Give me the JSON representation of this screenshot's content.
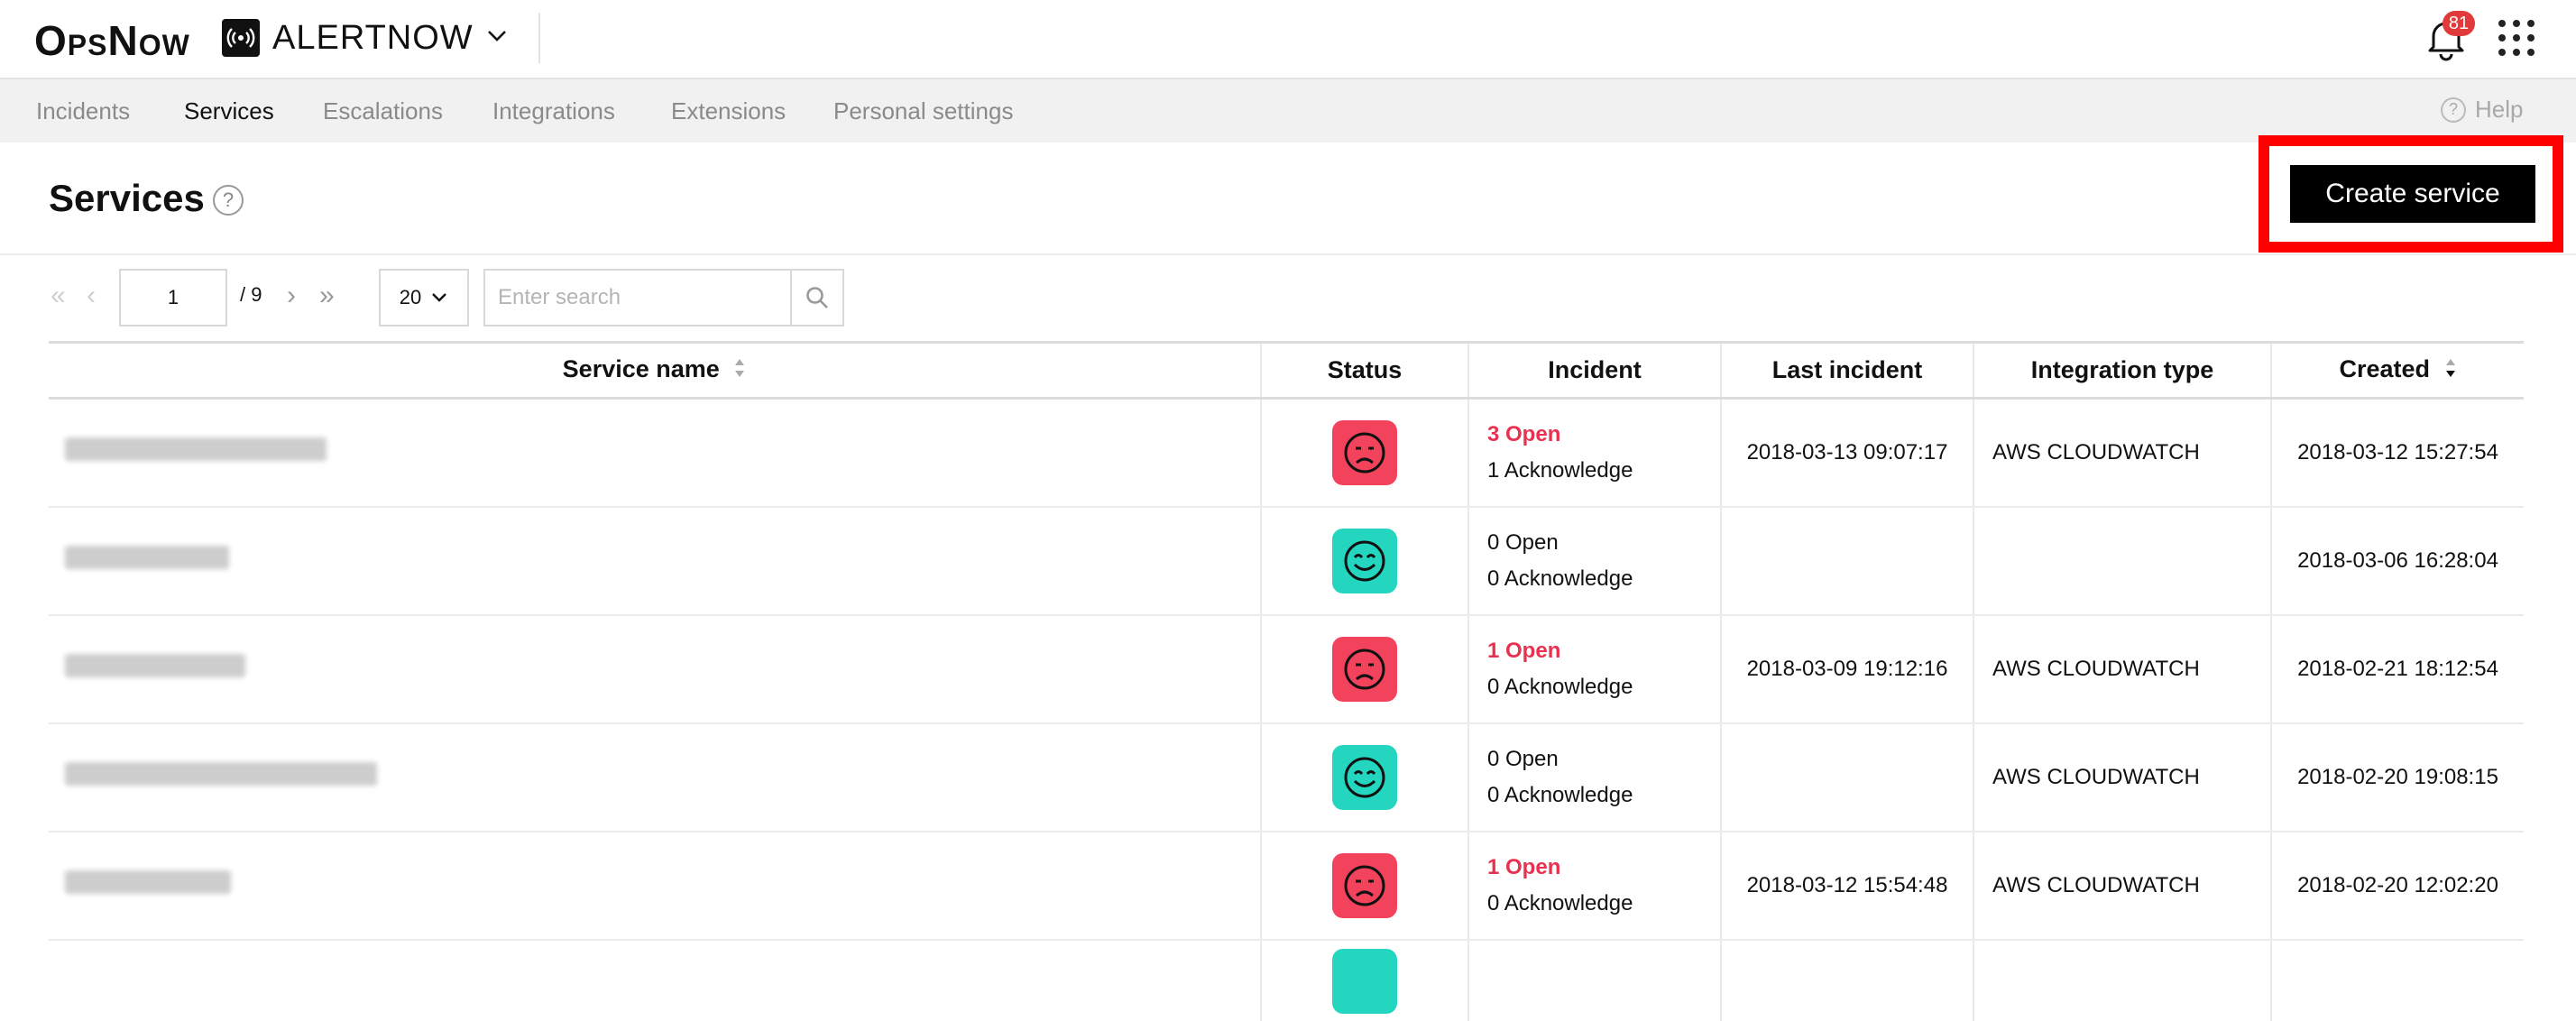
{
  "topbar": {
    "logo": "OpsNow",
    "app_name": "ALERTNOW",
    "notification_count": "81"
  },
  "nav": {
    "items": [
      "Incidents",
      "Services",
      "Escalations",
      "Integrations",
      "Extensions",
      "Personal settings"
    ],
    "active": "Services",
    "help_label": "Help"
  },
  "header": {
    "title": "Services",
    "create_button": "Create service"
  },
  "pager": {
    "current_page": "1",
    "total_pages": "/ 9",
    "per_page": "20",
    "search_placeholder": "Enter search"
  },
  "table": {
    "columns": [
      "Service name",
      "Status",
      "Incident",
      "Last incident",
      "Integration type",
      "Created"
    ],
    "rows": [
      {
        "status": "bad",
        "open": "3 Open",
        "ack": "1 Acknowledge",
        "last_incident": "2018-03-13 09:07:17",
        "integration": "AWS CLOUDWATCH",
        "created": "2018-03-12 15:27:54"
      },
      {
        "status": "good",
        "open": "0 Open",
        "ack": "0 Acknowledge",
        "last_incident": "",
        "integration": "",
        "created": "2018-03-06 16:28:04"
      },
      {
        "status": "bad",
        "open": "1 Open",
        "ack": "0 Acknowledge",
        "last_incident": "2018-03-09 19:12:16",
        "integration": "AWS CLOUDWATCH",
        "created": "2018-02-21 18:12:54"
      },
      {
        "status": "good",
        "open": "0 Open",
        "ack": "0 Acknowledge",
        "last_incident": "",
        "integration": "AWS CLOUDWATCH",
        "created": "2018-02-20 19:08:15"
      },
      {
        "status": "bad",
        "open": "1 Open",
        "ack": "0 Acknowledge",
        "last_incident": "2018-03-12 15:54:48",
        "integration": "AWS CLOUDWATCH",
        "created": "2018-02-20 12:02:20"
      }
    ]
  }
}
